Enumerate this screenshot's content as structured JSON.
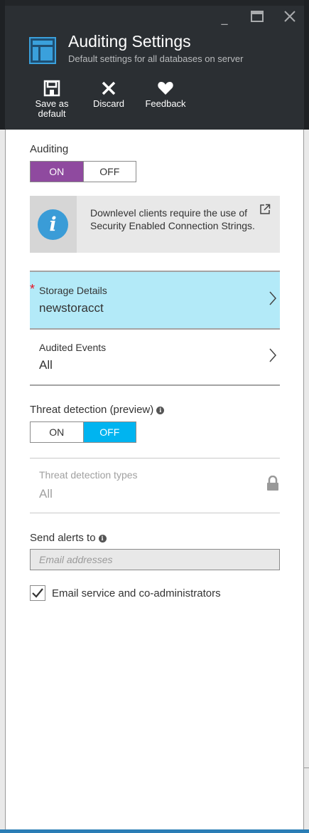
{
  "window": {
    "title": "Auditing Settings",
    "subtitle": "Default settings for all databases on server",
    "controls": {
      "minimize": "_",
      "maximize": "☐",
      "close": "✕"
    }
  },
  "commands": [
    {
      "line1": "Save as",
      "line2": "default",
      "icon": "save-icon"
    },
    {
      "line1": "Discard",
      "line2": "",
      "icon": "discard-icon"
    },
    {
      "line1": "Feedback",
      "line2": "",
      "icon": "heart-icon"
    }
  ],
  "auditing": {
    "label": "Auditing",
    "on_label": "ON",
    "off_label": "OFF",
    "selected": "ON"
  },
  "info_box": {
    "icon": "info-icon",
    "text": "Downlevel clients require the use of Security Enabled Connection Strings."
  },
  "storage_details": {
    "required_marker": "*",
    "label": "Storage Details",
    "value": "newstoracct"
  },
  "audited_events": {
    "label": "Audited Events",
    "value": "All"
  },
  "threat_detection": {
    "label": "Threat detection (preview)",
    "on_label": "ON",
    "off_label": "OFF",
    "selected": "OFF"
  },
  "threat_detection_types": {
    "label": "Threat detection types",
    "value": "All",
    "icon": "lock-icon"
  },
  "send_alerts": {
    "label": "Send alerts to",
    "placeholder": "Email addresses"
  },
  "email_admins": {
    "label": "Email service and co-administrators",
    "checked": true
  },
  "colors": {
    "header_bg": "#2b2f33",
    "on_active": "#8f4a9f",
    "off_active": "#00b4f0",
    "selected_row": "#b3eaf8",
    "required": "#e81123"
  }
}
